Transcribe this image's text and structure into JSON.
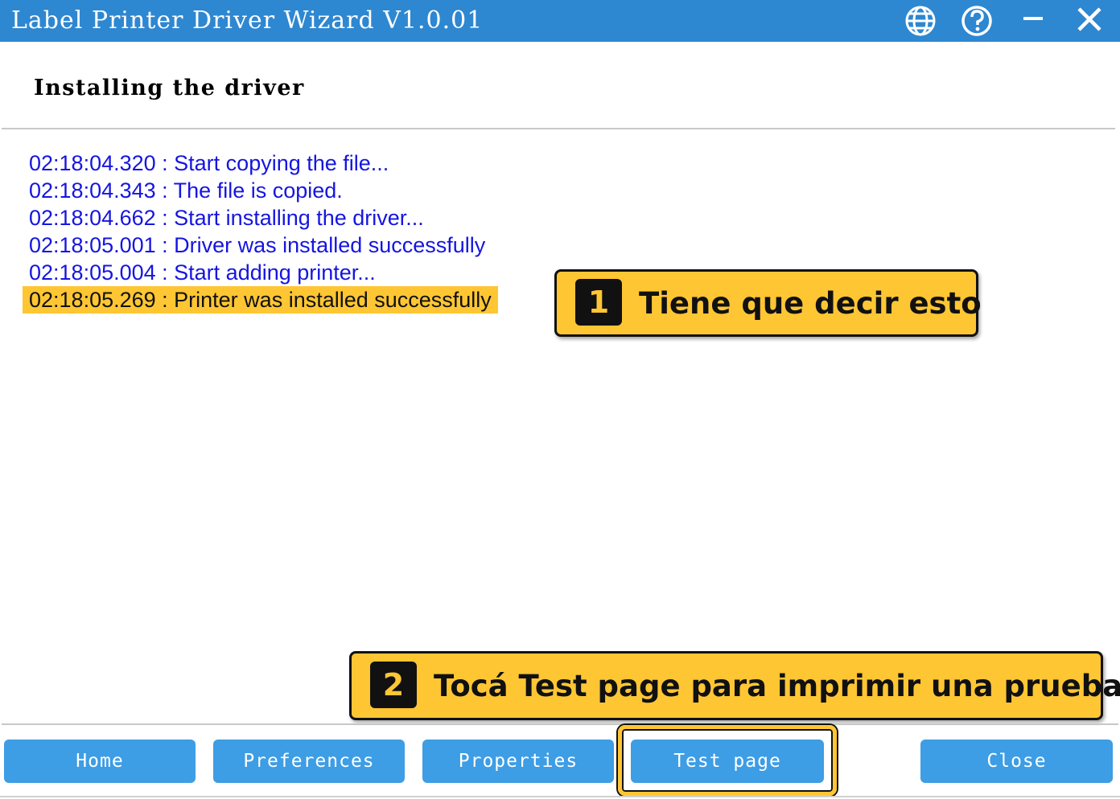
{
  "window": {
    "title": "Label Printer Driver Wizard  V1.0.01",
    "icons": [
      "globe-icon",
      "help-icon",
      "minimize-icon",
      "close-icon"
    ],
    "accent_color": "#2e87d1"
  },
  "page": {
    "heading": "Installing the driver"
  },
  "log": [
    "02:18:04.320 : Start copying the file...",
    "02:18:04.343 : The file is copied.",
    "02:18:04.662 : Start installing the driver...",
    "02:18:05.001 : Driver was installed successfully",
    "02:18:05.004 : Start adding printer...",
    "02:18:05.269 : Printer was installed successfully"
  ],
  "log_color": "#1515e0",
  "annotations": [
    {
      "number": "1",
      "text": "Tiene que decir esto"
    },
    {
      "number": "2",
      "text": "Tocá Test page para imprimir una prueba"
    }
  ],
  "annotation_color": "#ffc634",
  "buttons": {
    "home": "Home",
    "preferences": "Preferences",
    "properties": "Properties",
    "test_page": "Test page",
    "close": "Close"
  },
  "button_color": "#3d9de5"
}
